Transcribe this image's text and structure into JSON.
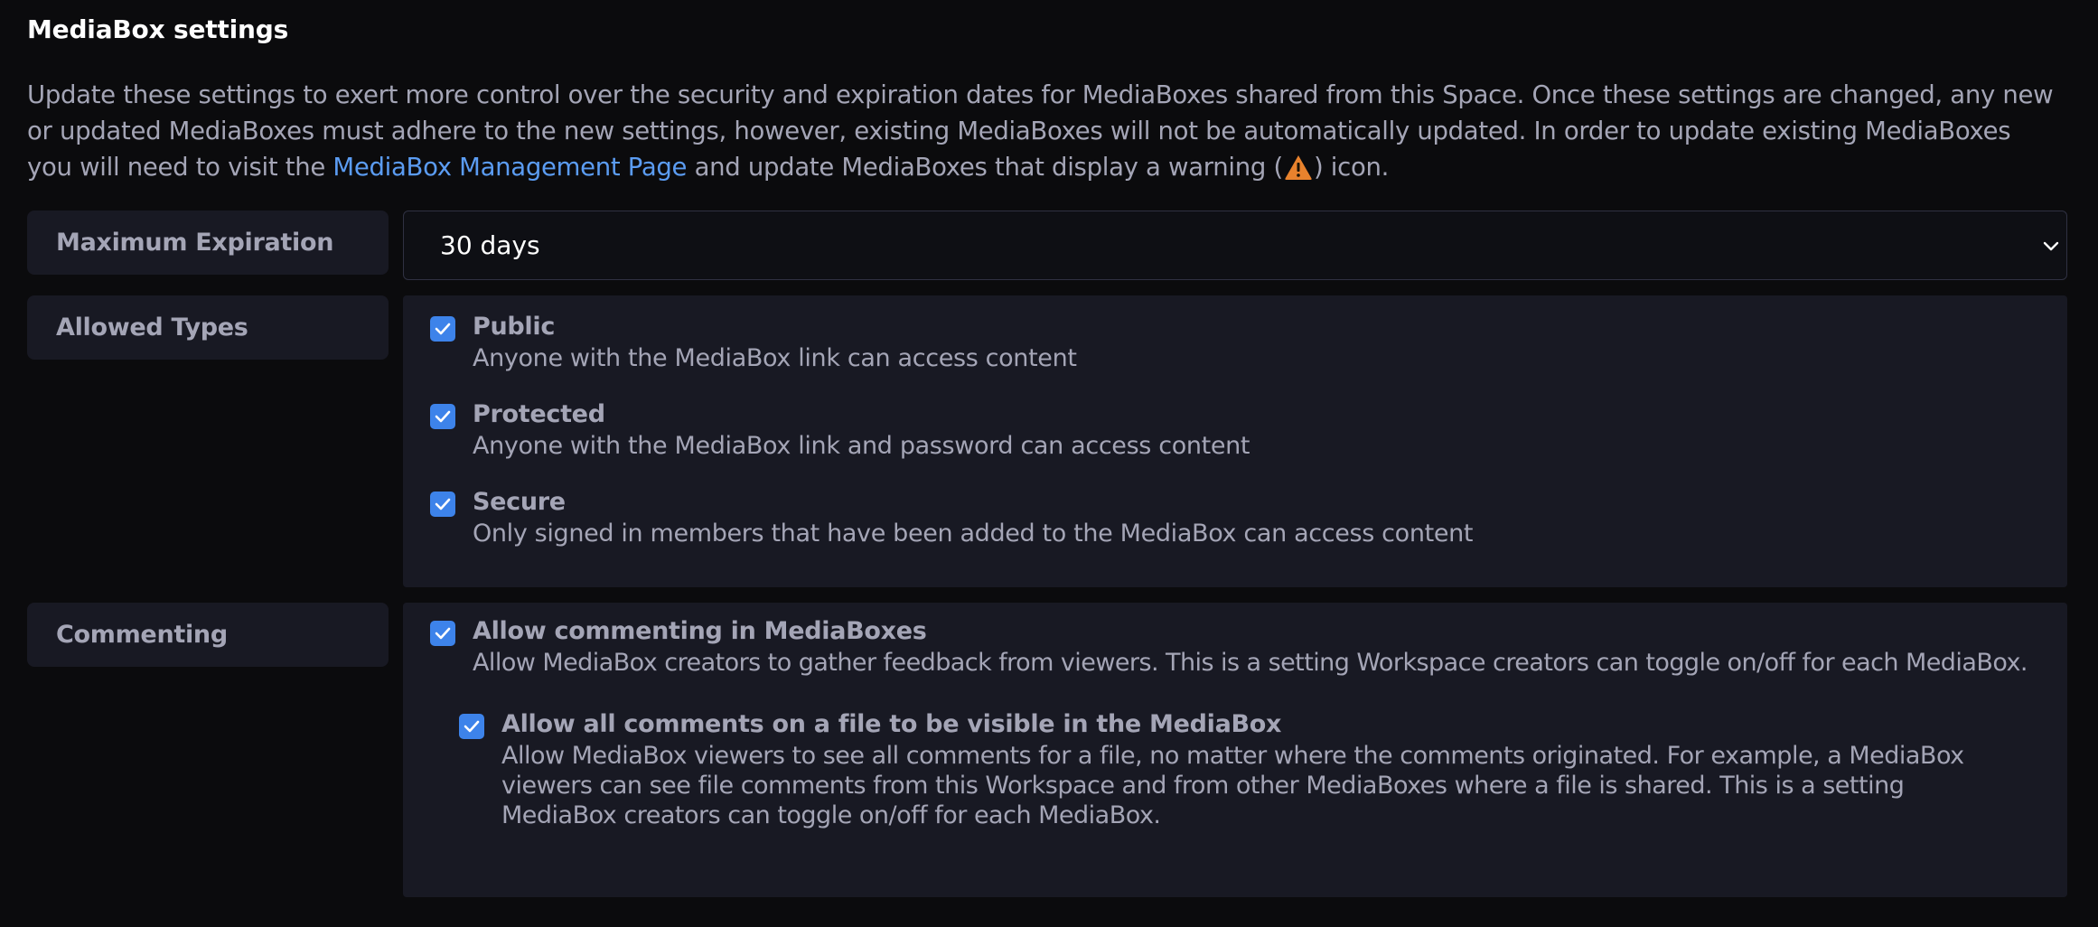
{
  "page": {
    "title": "MediaBox settings",
    "intro_before_link": "Update these settings to exert more control over the security and expiration dates for MediaBoxes shared from this Space. Once these settings are changed, any new or updated MediaBoxes must adhere to the new settings, however, existing MediaBoxes will not be automatically updated. In order to update existing MediaBoxes you will need to visit the ",
    "intro_link": "MediaBox Management Page",
    "intro_after_link": " and update MediaBoxes that display a warning (",
    "intro_end": ") icon."
  },
  "colors": {
    "background": "#0b0b0d",
    "panel": "#181923",
    "link": "#5b9cf2",
    "checkbox": "#3d83ea",
    "warning": "#e8822d"
  },
  "icons": {
    "warning": "warning-triangle-icon",
    "checkbox": "checkmark-icon",
    "select": "chevron-down-icon"
  },
  "expiration": {
    "label": "Maximum Expiration",
    "value": "30 days"
  },
  "allowed_types": {
    "label": "Allowed Types",
    "options": [
      {
        "title": "Public",
        "description": "Anyone with the MediaBox link can access content",
        "checked": true
      },
      {
        "title": "Protected",
        "description": "Anyone with the MediaBox link and password can access content",
        "checked": true
      },
      {
        "title": "Secure",
        "description": "Only signed in members that have been added to the MediaBox can access content",
        "checked": true
      }
    ]
  },
  "commenting": {
    "label": "Commenting",
    "allow": {
      "title": "Allow commenting in MediaBoxes",
      "description": "Allow MediaBox creators to gather feedback from viewers. This is a setting Workspace creators can toggle on/off for each MediaBox.",
      "checked": true
    },
    "visible": {
      "title": "Allow all comments on a file to be visible in the MediaBox",
      "description_lines": [
        "Allow MediaBox viewers to see all comments for a file, no matter where the comments originated. For example, a MediaBox",
        "viewers can see file comments from this Workspace and from other MediaBoxes where a file is shared. This is a setting",
        "MediaBox creators can toggle on/off for each MediaBox."
      ],
      "checked": true
    }
  }
}
